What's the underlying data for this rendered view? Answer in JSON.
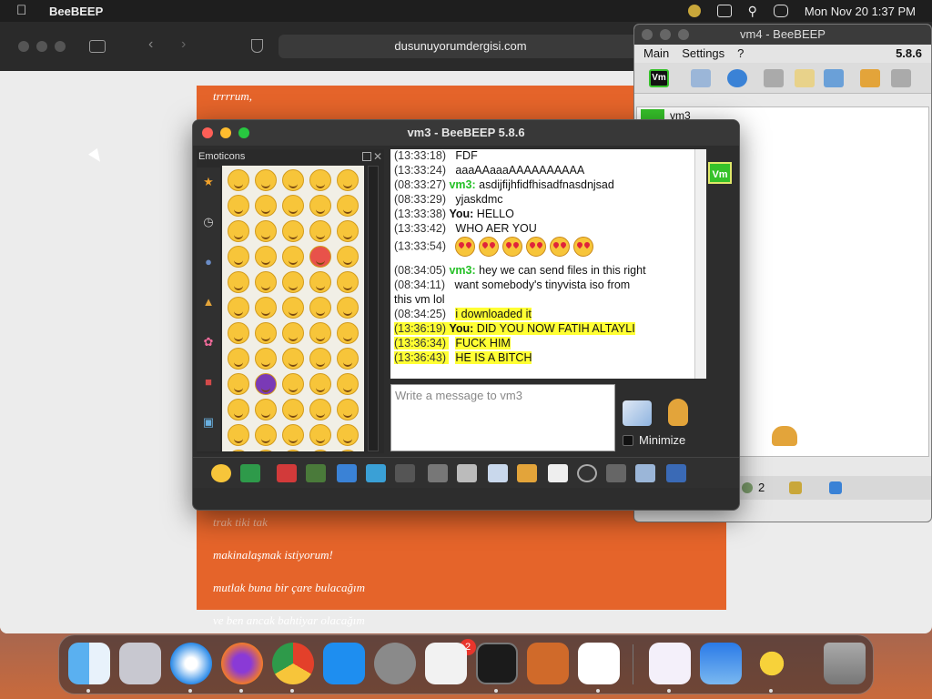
{
  "menubar": {
    "app_name": "BeeBEEP",
    "datetime": "Mon Nov 20  1:37 PM"
  },
  "browser": {
    "url": "dusunuyorumdergisi.com",
    "page_lines": [
      "trrrrum,",
      "trak tiki tak",
      "makinalaşmak istiyorum!",
      "mutlak buna bir çare bulacağım",
      "ve ben ancak bahtiyar olacağım"
    ]
  },
  "vm4": {
    "title": "vm4 - BeeBEEP",
    "menu": [
      "Main",
      "Settings",
      "?"
    ],
    "version": "5.8.6",
    "user_label": "vm3",
    "count": "2"
  },
  "vm3": {
    "title": "vm3 - BeeBEEP 5.8.6",
    "emoticons_label": "Emoticons",
    "input_placeholder": "Write a message to vm3",
    "minimize_label": "Minimize",
    "side_badge": "Vm",
    "messages": [
      {
        "time": "(13:33:18)",
        "sender": "",
        "text": "FDF",
        "highlight": false
      },
      {
        "time": "(13:33:24)",
        "sender": "",
        "text": "aaaAAaaaAAAAAAAAAA",
        "highlight": false
      },
      {
        "time": "(08:33:27)",
        "sender": "vm3:",
        "text": "asdijfijhfidfhisadfnasdnjsad",
        "highlight": false
      },
      {
        "time": "(08:33:29)",
        "sender": "",
        "text": "yjaskdmc",
        "highlight": false
      },
      {
        "time": "(13:33:38)",
        "sender": "You:",
        "text": "HELLO",
        "highlight": false
      },
      {
        "time": "(13:33:42)",
        "sender": "",
        "text": "WHO AER YOU",
        "highlight": false
      },
      {
        "time": "(13:33:54)",
        "sender": "",
        "text": "",
        "highlight": false
      },
      {
        "time": "(08:34:05)",
        "sender": "vm3:",
        "text": "hey we can send files in this right",
        "highlight": false
      },
      {
        "time": "(08:34:11)",
        "sender": "",
        "text": "want somebody's tinyvista iso from",
        "highlight": false
      },
      {
        "time": "",
        "sender": "",
        "text": "this vm lol",
        "highlight": false
      },
      {
        "time": "(08:34:25)",
        "sender": "",
        "text": "i downloaded it",
        "highlight": false
      },
      {
        "time": "(13:36:19)",
        "sender": "You:",
        "text": "DID YOU NOW FATIH ALTAYLI",
        "highlight": true
      },
      {
        "time": "(13:36:34)",
        "sender": "",
        "text": "FUCK HIM",
        "highlight": true
      },
      {
        "time": "(13:36:43)",
        "sender": "",
        "text": "HE IS A BITCH",
        "highlight": true
      }
    ]
  },
  "dock": {
    "settings_badge": "2"
  },
  "colors": {
    "accent_orange": "#e5642a",
    "vm3_green": "#25c027",
    "highlight_yellow": "#ffff33"
  }
}
